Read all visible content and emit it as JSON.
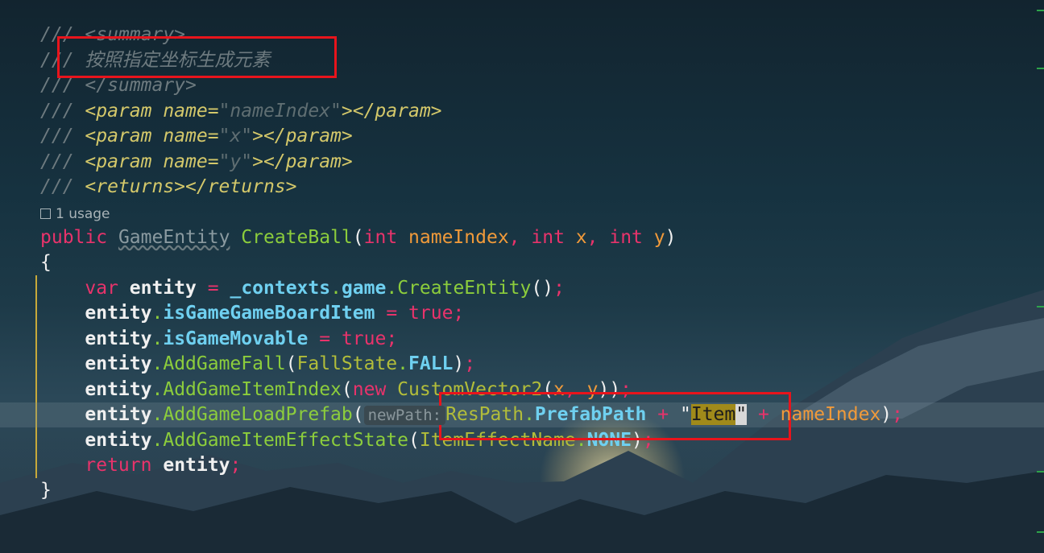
{
  "code": {
    "doc": {
      "prefix": "/// ",
      "summary_open": "<summary>",
      "summary_text": "按照指定坐标生成元素",
      "summary_close": "</summary>",
      "param_open": "<param name=",
      "param_close": "></param>",
      "params": [
        "\"nameIndex\"",
        "\"x\"",
        "\"y\""
      ],
      "returns": "<returns></returns>"
    },
    "usage": "1 usage",
    "signature": {
      "modifier": "public",
      "return_type": "GameEntity",
      "method": "CreateBall",
      "p1_type": "int",
      "p1_name": "nameIndex",
      "p2_type": "int",
      "p2_name": "x",
      "p3_type": "int",
      "p3_name": "y"
    },
    "body": {
      "var": "var",
      "entity": "entity",
      "contexts": "_contexts",
      "game": "game",
      "create_entity": "CreateEntity",
      "is_board_item": "isGameGameBoardItem",
      "is_movable": "isGameMovable",
      "true_kw": "true",
      "add_fall": "AddGameFall",
      "fall_state": "FallState",
      "fall": "FALL",
      "add_item_index": "AddGameItemIndex",
      "new_kw": "new",
      "custom_vector": "CustomVector2",
      "add_load_prefab": "AddGameLoadPrefab",
      "hint_label": "newPath:",
      "res_path": "ResPath",
      "prefab_path": "PrefabPath",
      "str_item": "Item",
      "name_index": "nameIndex",
      "add_effect": "AddGameItemEffectState",
      "effect_name": "ItemEffectName",
      "none": "NONE",
      "return_kw": "return"
    }
  },
  "colors": {
    "keyword": "#e8336b",
    "type": "#b2bd3a",
    "method": "#8ccd3c",
    "parameter": "#f09a3a",
    "field": "#6fd0f0",
    "comment": "#6d7a7f",
    "annotation_box": "#e8141c"
  }
}
